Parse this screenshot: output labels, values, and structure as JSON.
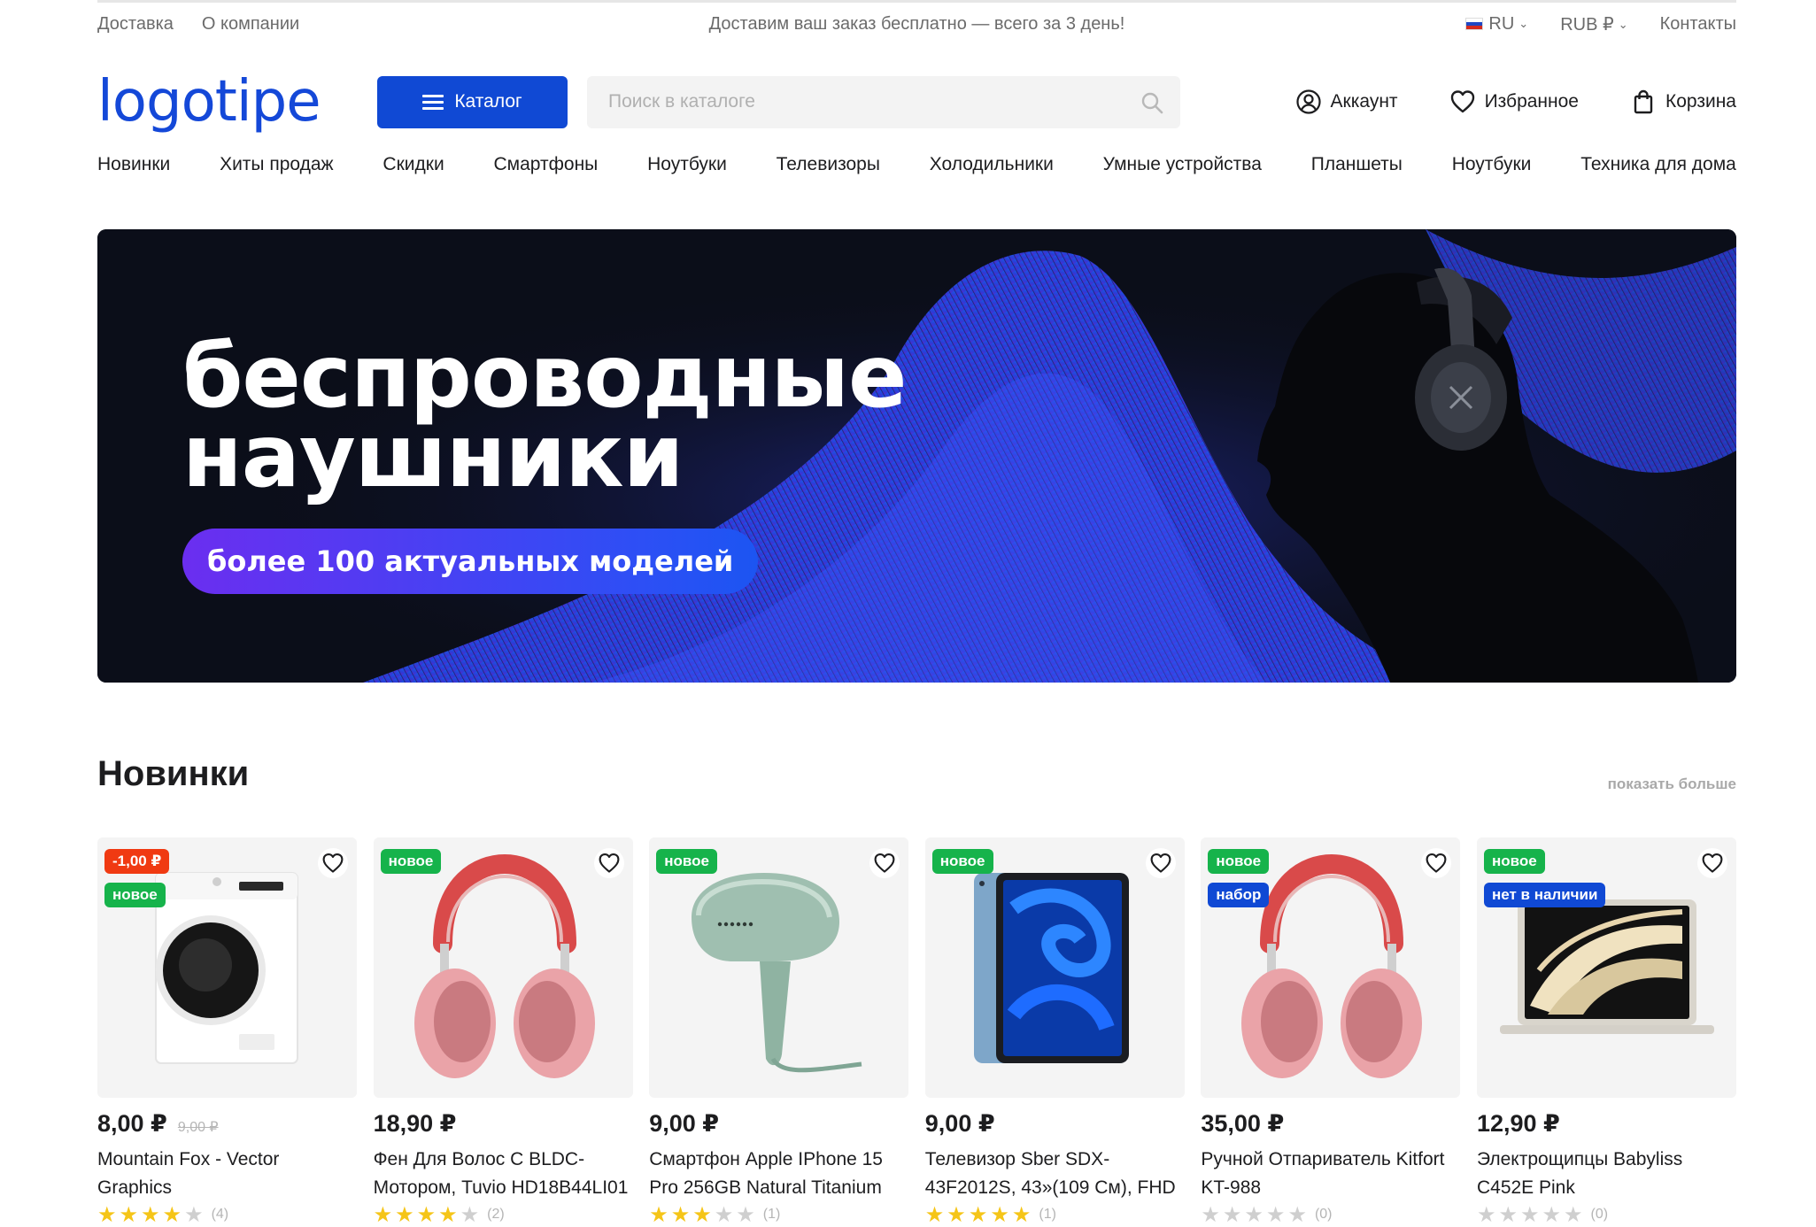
{
  "topbar": {
    "delivery": "Доставка",
    "about": "О компании",
    "promo": "Доставим ваш заказ бесплатно — всего за 3 день!",
    "language": "RU",
    "currency": "RUB ₽",
    "contacts": "Контакты"
  },
  "header": {
    "logo": "logotipe",
    "catalog_label": "Каталог",
    "search_placeholder": "Поиск в каталоге",
    "account": "Аккаунт",
    "favorites": "Избранное",
    "cart": "Корзина"
  },
  "nav": [
    "Новинки",
    "Хиты продаж",
    "Скидки",
    "Смартфоны",
    "Ноутбуки",
    "Телевизоры",
    "Холодильники",
    "Умные устройства",
    "Планшеты",
    "Ноутбуки",
    "Техника для дома"
  ],
  "banner": {
    "title_line1": "беспроводные",
    "title_line2": "наушники",
    "pill": "более 100 актуальных моделей"
  },
  "section": {
    "title": "Новинки",
    "show_more": "показать больше"
  },
  "products": [
    {
      "badges": [
        {
          "text": "-1,00 ₽",
          "kind": "sale"
        },
        {
          "text": "новое",
          "kind": "new"
        }
      ],
      "price": "8,00 ₽",
      "old_price": "9,00 ₽",
      "name": "Mountain Fox - Vector Graphics",
      "rating": 4,
      "reviews": "(4)",
      "image": "washing-machine"
    },
    {
      "badges": [
        {
          "text": "новое",
          "kind": "new"
        }
      ],
      "price": "18,90 ₽",
      "old_price": "",
      "name": "Фен Для Волос С BLDC-Мотором, Tuvio HD18B44LI01",
      "rating": 4,
      "reviews": "(2)",
      "image": "headphones"
    },
    {
      "badges": [
        {
          "text": "новое",
          "kind": "new"
        }
      ],
      "price": "9,00 ₽",
      "old_price": "",
      "name": "Смартфон Apple IPhone 15 Pro 256GB Natural Titanium",
      "rating": 3,
      "reviews": "(1)",
      "image": "steamer"
    },
    {
      "badges": [
        {
          "text": "новое",
          "kind": "new"
        }
      ],
      "price": "9,00 ₽",
      "old_price": "",
      "name": "Телевизор Sber SDX-43F2012S, 43»(109 См), FHD",
      "rating": 5,
      "reviews": "(1)",
      "image": "tablet"
    },
    {
      "badges": [
        {
          "text": "новое",
          "kind": "new"
        },
        {
          "text": "набор",
          "kind": "blue"
        }
      ],
      "price": "35,00 ₽",
      "old_price": "",
      "name": "Ручной Отпариватель Kitfort KT-988",
      "rating": 0,
      "reviews": "(0)",
      "image": "headphones"
    },
    {
      "badges": [
        {
          "text": "новое",
          "kind": "new"
        },
        {
          "text": "нет в наличии",
          "kind": "blue"
        }
      ],
      "price": "12,90 ₽",
      "old_price": "",
      "name": "Электрощипцы Babyliss C452E Pink",
      "rating": 0,
      "reviews": "(0)",
      "image": "laptop"
    }
  ],
  "colors": {
    "accent": "#1049d4",
    "new_badge": "#16b34b",
    "sale_badge": "#f03a12",
    "star": "#f5c518"
  }
}
